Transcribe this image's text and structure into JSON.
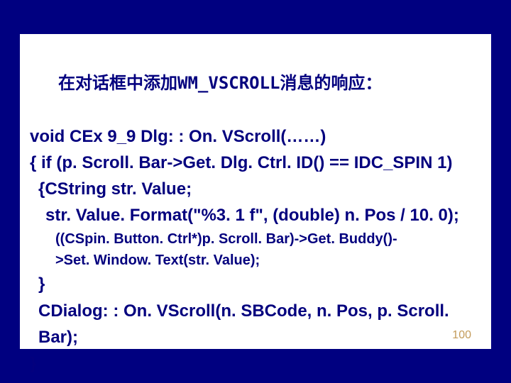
{
  "slide": {
    "title_prefix": "在对话框中添加",
    "title_wm": "WM_VSCROLL",
    "title_suffix": "消息的响应：",
    "line1": "void CEx 9_9 Dlg: : On. VScroll(……)",
    "line2": "{ if (p. Scroll. Bar->Get. Dlg. Ctrl. ID() == IDC_SPIN 1)",
    "line3": "{CString str. Value;",
    "line4": "str. Value. Format(\"%3. 1 f\", (double) n. Pos / 10. 0);",
    "line5a": "((CSpin. Button. Ctrl*)p. Scroll. Bar)->Get. Buddy()-",
    "line5b": ">Set. Window. Text(str. Value);",
    "line6": "}",
    "line7": "CDialog: : On. VScroll(n. SBCode, n. Pos, p. Scroll. Bar);",
    "line8": "}",
    "page_number": "100"
  }
}
